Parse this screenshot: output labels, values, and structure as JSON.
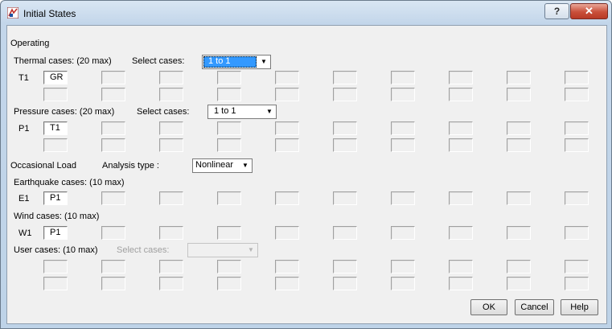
{
  "window": {
    "title": "Initial States",
    "help_glyph": "?",
    "close_glyph": "✕"
  },
  "operating": {
    "section_label": "Operating",
    "thermal": {
      "label": "Thermal cases: (20 max)",
      "select_label": "Select cases:",
      "select_value": "1 to 1",
      "row_label": "T1",
      "first_value": "GR"
    },
    "pressure": {
      "label": "Pressure cases: (20 max)",
      "select_label": "Select cases:",
      "select_value": "1 to 1",
      "row_label": "P1",
      "first_value": "T1"
    }
  },
  "occasional": {
    "section_label": "Occasional Load",
    "analysis_label": "Analysis type :",
    "analysis_value": "Nonlinear",
    "earthquake": {
      "label": "Earthquake cases: (10 max)",
      "row_label": "E1",
      "first_value": "P1"
    },
    "wind": {
      "label": "Wind cases: (10 max)",
      "row_label": "W1",
      "first_value": "P1"
    },
    "user": {
      "label": "User cases: (10 max)",
      "select_label": "Select cases:",
      "select_value": ""
    }
  },
  "buttons": {
    "ok": "OK",
    "cancel": "Cancel",
    "help": "Help"
  },
  "icons": {
    "dropdown": "▼"
  }
}
